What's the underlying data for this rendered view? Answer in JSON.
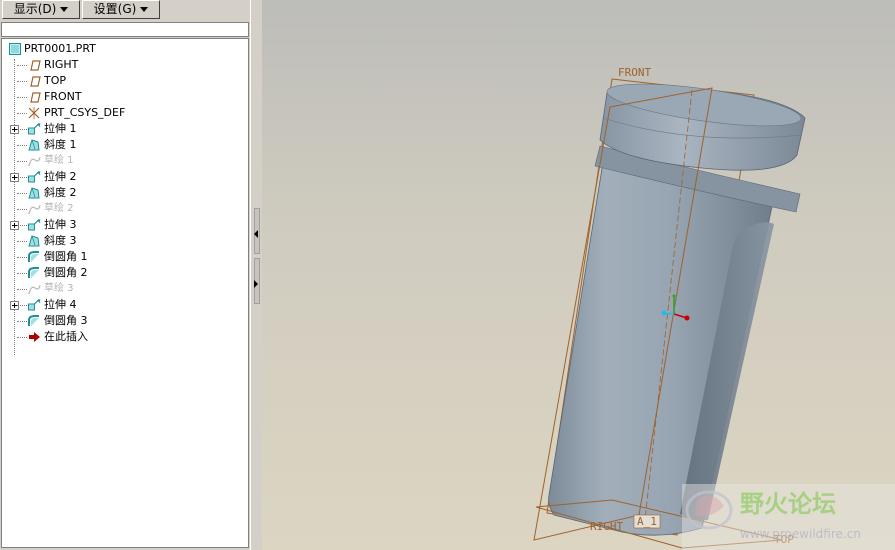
{
  "toolbar": {
    "display_label": "显示(D)",
    "settings_label": "设置(G)"
  },
  "model_tree": {
    "root": "PRT0001.PRT",
    "items": [
      {
        "label": "RIGHT",
        "icon": "datum-plane-icon",
        "muted": false,
        "expandable": false
      },
      {
        "label": "TOP",
        "icon": "datum-plane-icon",
        "muted": false,
        "expandable": false
      },
      {
        "label": "FRONT",
        "icon": "datum-plane-icon",
        "muted": false,
        "expandable": false
      },
      {
        "label": "PRT_CSYS_DEF",
        "icon": "csys-icon",
        "muted": false,
        "expandable": false
      },
      {
        "label": "拉伸 1",
        "icon": "extrude-icon",
        "muted": false,
        "expandable": true
      },
      {
        "label": "斜度 1",
        "icon": "draft-icon",
        "muted": false,
        "expandable": false
      },
      {
        "label": "草绘 1",
        "icon": "sketch-icon",
        "muted": true,
        "expandable": false
      },
      {
        "label": "拉伸 2",
        "icon": "extrude-icon",
        "muted": false,
        "expandable": true
      },
      {
        "label": "斜度 2",
        "icon": "draft-icon",
        "muted": false,
        "expandable": false
      },
      {
        "label": "草绘 2",
        "icon": "sketch-icon",
        "muted": true,
        "expandable": false
      },
      {
        "label": "拉伸 3",
        "icon": "extrude-icon",
        "muted": false,
        "expandable": true
      },
      {
        "label": "斜度 3",
        "icon": "draft-icon",
        "muted": false,
        "expandable": false
      },
      {
        "label": "倒圆角 1",
        "icon": "round-icon",
        "muted": false,
        "expandable": false
      },
      {
        "label": "倒圆角 2",
        "icon": "round-icon",
        "muted": false,
        "expandable": false
      },
      {
        "label": "草绘 3",
        "icon": "sketch-icon",
        "muted": true,
        "expandable": false
      },
      {
        "label": "拉伸 4",
        "icon": "extrude-icon",
        "muted": false,
        "expandable": true
      },
      {
        "label": "倒圆角 3",
        "icon": "round-icon",
        "muted": false,
        "expandable": false
      },
      {
        "label": "在此插入",
        "icon": "insert-here-arrow-icon",
        "muted": false,
        "expandable": false
      }
    ]
  },
  "viewport": {
    "datum_front": "FRONT",
    "datum_right": "RIGHT",
    "datum_top": "TOP",
    "axis_label": "A_1",
    "watermark": "野火论坛",
    "watermark_url": "www.proewildfire.cn"
  },
  "colors": {
    "datum": "#a0622a",
    "part_body": "#8a9aaa",
    "accent_red": "#cc0000"
  }
}
